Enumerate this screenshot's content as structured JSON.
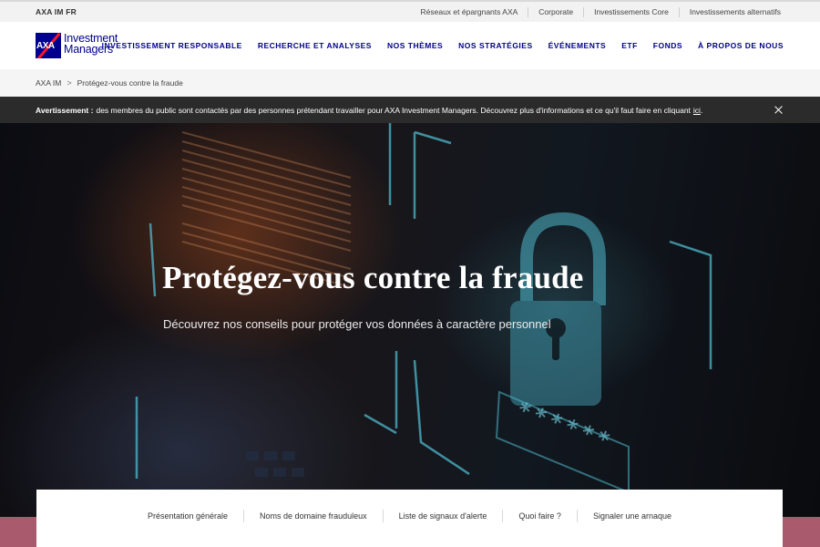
{
  "utility": {
    "brand": "AXA IM FR",
    "links": [
      "Réseaux et épargnants AXA",
      "Corporate",
      "Investissements Core",
      "Investissements alternatifs"
    ]
  },
  "header": {
    "logo_mark": "AXA",
    "logo_line1": "Investment",
    "logo_line2": "Managers",
    "nav": [
      "INVESTISSEMENT RESPONSABLE",
      "RECHERCHE ET ANALYSES",
      "NOS THÈMES",
      "NOS STRATÉGIES",
      "ÉVÉNEMENTS",
      "ETF",
      "FONDS",
      "À PROPOS DE NOUS"
    ]
  },
  "breadcrumb": {
    "root": "AXA IM",
    "separator": ">",
    "current": "Protégez-vous contre la fraude"
  },
  "warning": {
    "label": "Avertissement :",
    "text": "des membres du public sont contactés par des personnes prétendant travailler pour AXA Investment Managers. Découvrez plus d'informations et ce qu'il faut faire en cliquant",
    "link": "ici",
    "end": ".",
    "close_icon": "close-icon"
  },
  "hero": {
    "title": "Protégez-vous contre la fraude",
    "subtitle": "Découvrez nos conseils pour protéger vos données à caractère personnel",
    "password_mask": "******"
  },
  "tabs": [
    "Présentation générale",
    "Noms de domaine frauduleux",
    "Liste de signaux d'alerte",
    "Quoi faire ?",
    "Signaler une arnaque"
  ],
  "colors": {
    "brand_blue": "#00008f",
    "brand_red": "#ff1721",
    "warning_bg": "#2b2b2b",
    "band": "#a95a6c",
    "hero_accent": "#5fc4d8"
  }
}
